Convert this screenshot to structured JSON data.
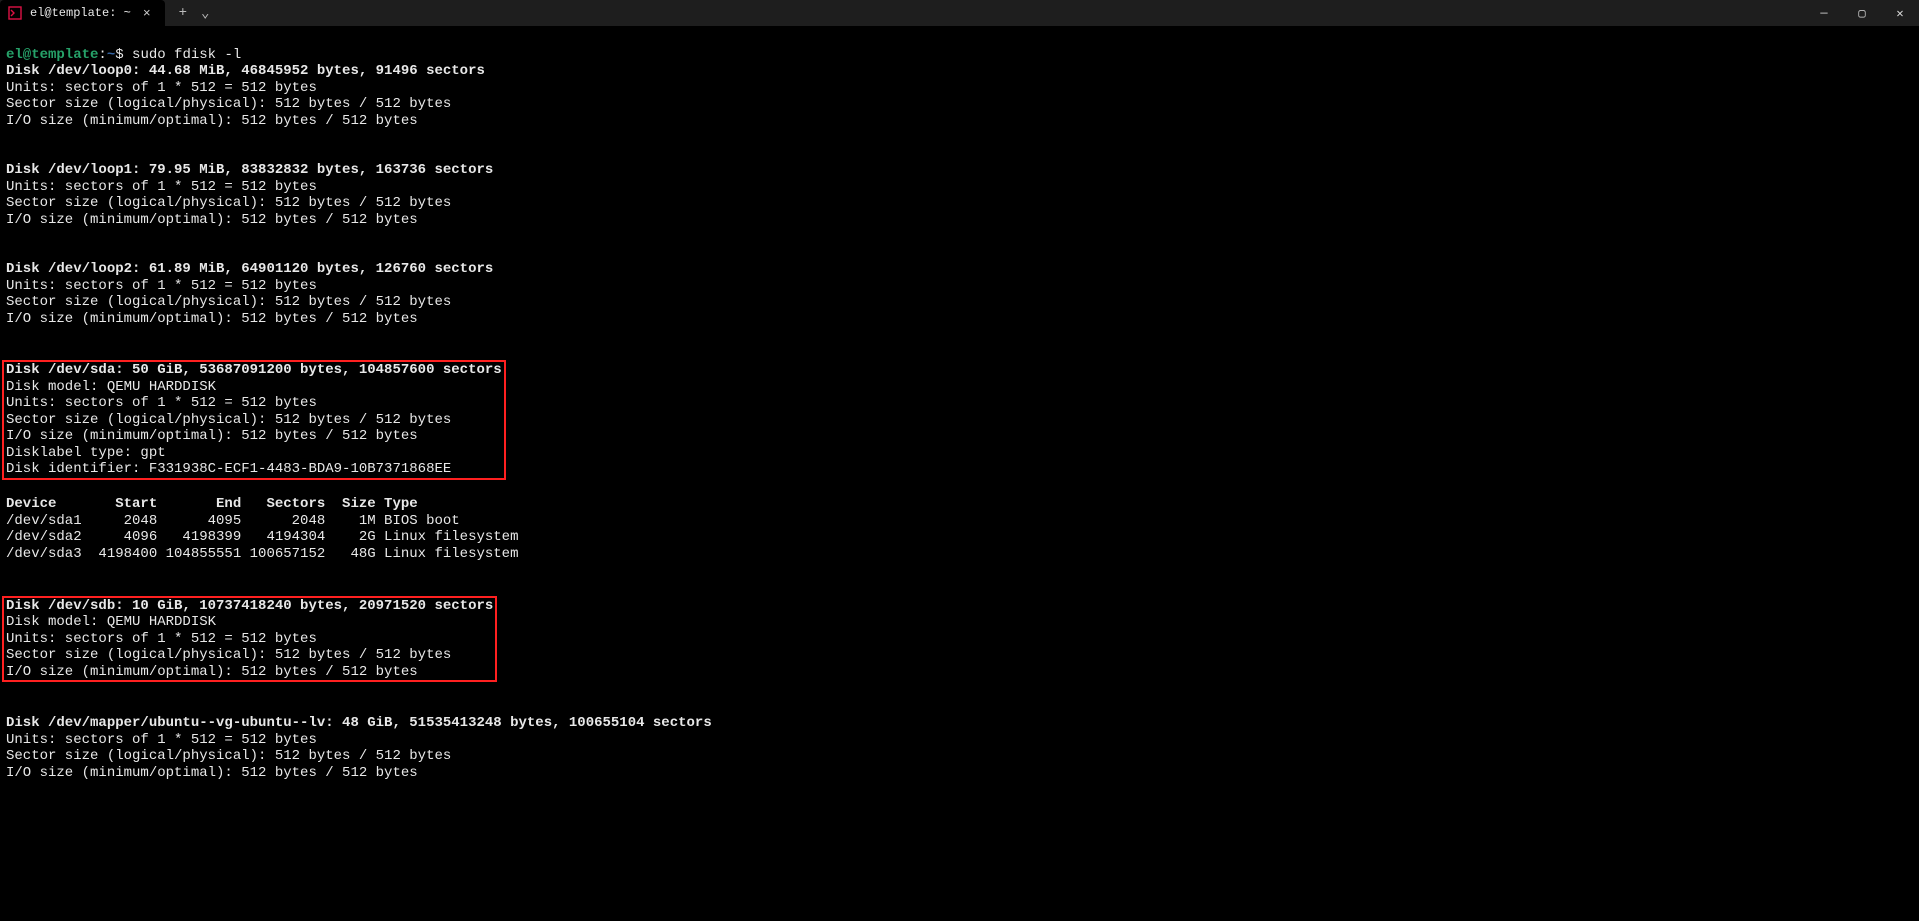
{
  "titlebar": {
    "tab_title": "el@template: ~",
    "tab_icon_char": "⌘",
    "close_glyph": "×",
    "new_tab_glyph": "+",
    "dropdown_glyph": "⌄",
    "minimize_glyph": "—",
    "maximize_glyph": "▢",
    "window_close_glyph": "✕"
  },
  "prompt": {
    "user_host": "el@template",
    "sep": ":",
    "cwd": "~",
    "dollar": "$ ",
    "command": "sudo fdisk -l"
  },
  "disks": {
    "loop0": [
      "Disk /dev/loop0: 44.68 MiB, 46845952 bytes, 91496 sectors",
      "Units: sectors of 1 * 512 = 512 bytes",
      "Sector size (logical/physical): 512 bytes / 512 bytes",
      "I/O size (minimum/optimal): 512 bytes / 512 bytes"
    ],
    "loop1": [
      "Disk /dev/loop1: 79.95 MiB, 83832832 bytes, 163736 sectors",
      "Units: sectors of 1 * 512 = 512 bytes",
      "Sector size (logical/physical): 512 bytes / 512 bytes",
      "I/O size (minimum/optimal): 512 bytes / 512 bytes"
    ],
    "loop2": [
      "Disk /dev/loop2: 61.89 MiB, 64901120 bytes, 126760 sectors",
      "Units: sectors of 1 * 512 = 512 bytes",
      "Sector size (logical/physical): 512 bytes / 512 bytes",
      "I/O size (minimum/optimal): 512 bytes / 512 bytes"
    ],
    "sda_block": [
      "Disk /dev/sda: 50 GiB, 53687091200 bytes, 104857600 sectors",
      "Disk model: QEMU HARDDISK",
      "Units: sectors of 1 * 512 = 512 bytes",
      "Sector size (logical/physical): 512 bytes / 512 bytes",
      "I/O size (minimum/optimal): 512 bytes / 512 bytes",
      "Disklabel type: gpt",
      "Disk identifier: F331938C-ECF1-4483-BDA9-10B7371868EE"
    ],
    "sda_table_header": "Device       Start       End   Sectors  Size Type",
    "sda_table_rows": [
      "/dev/sda1     2048      4095      2048    1M BIOS boot",
      "/dev/sda2     4096   4198399   4194304    2G Linux filesystem",
      "/dev/sda3  4198400 104855551 100657152   48G Linux filesystem"
    ],
    "sdb_block": [
      "Disk /dev/sdb: 10 GiB, 10737418240 bytes, 20971520 sectors",
      "Disk model: QEMU HARDDISK",
      "Units: sectors of 1 * 512 = 512 bytes",
      "Sector size (logical/physical): 512 bytes / 512 bytes",
      "I/O size (minimum/optimal): 512 bytes / 512 bytes"
    ],
    "mapper": [
      "Disk /dev/mapper/ubuntu--vg-ubuntu--lv: 48 GiB, 51535413248 bytes, 100655104 sectors",
      "Units: sectors of 1 * 512 = 512 bytes",
      "Sector size (logical/physical): 512 bytes / 512 bytes",
      "I/O size (minimum/optimal): 512 bytes / 512 bytes"
    ]
  }
}
